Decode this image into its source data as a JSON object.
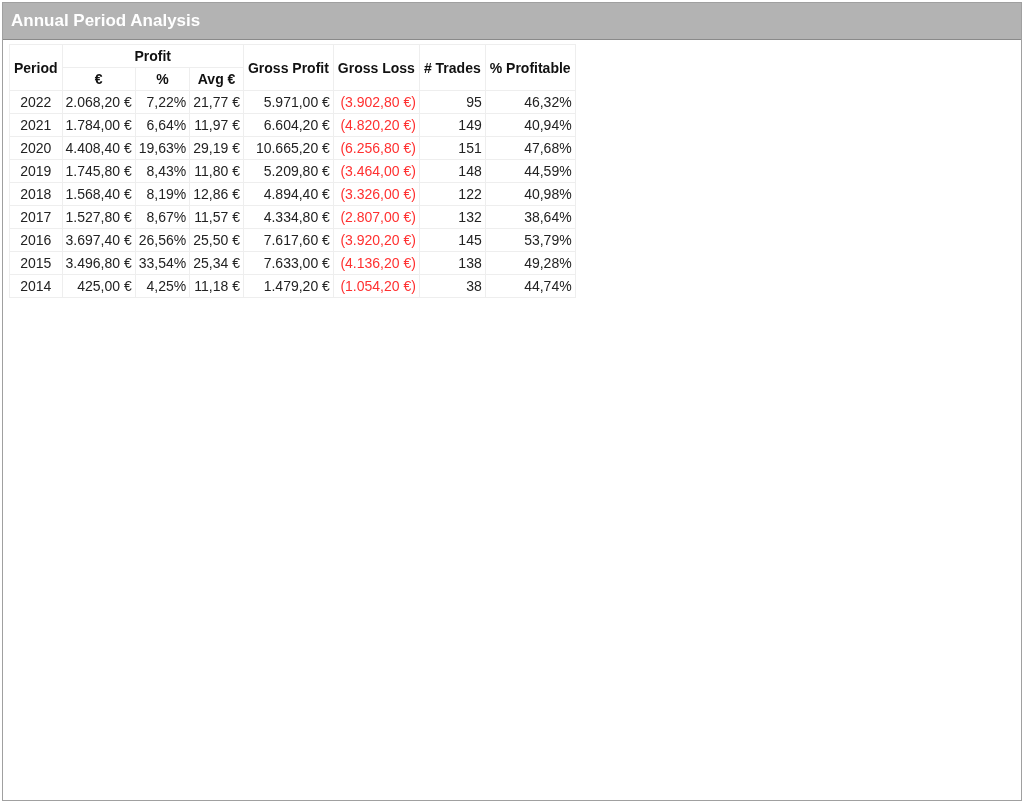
{
  "window": {
    "title": "Annual Period Analysis"
  },
  "table": {
    "columns": {
      "period": "Period",
      "profit": "Profit",
      "profit_sub": [
        "€",
        "%",
        "Avg €"
      ],
      "gross_profit": "Gross Profit",
      "gross_loss": "Gross Loss",
      "trades": "# Trades",
      "pct_profitable": "% Profitable"
    },
    "rows": [
      [
        "2022",
        "2.068,20 €",
        "7,22%",
        "21,77 €",
        "5.971,00 €",
        "(3.902,80 €)",
        "95",
        "46,32%"
      ],
      [
        "2021",
        "1.784,00 €",
        "6,64%",
        "11,97 €",
        "6.604,20 €",
        "(4.820,20 €)",
        "149",
        "40,94%"
      ],
      [
        "2020",
        "4.408,40 €",
        "19,63%",
        "29,19 €",
        "10.665,20 €",
        "(6.256,80 €)",
        "151",
        "47,68%"
      ],
      [
        "2019",
        "1.745,80 €",
        "8,43%",
        "11,80 €",
        "5.209,80 €",
        "(3.464,00 €)",
        "148",
        "44,59%"
      ],
      [
        "2018",
        "1.568,40 €",
        "8,19%",
        "12,86 €",
        "4.894,40 €",
        "(3.326,00 €)",
        "122",
        "40,98%"
      ],
      [
        "2017",
        "1.527,80 €",
        "8,67%",
        "11,57 €",
        "4.334,80 €",
        "(2.807,00 €)",
        "132",
        "38,64%"
      ],
      [
        "2016",
        "3.697,40 €",
        "26,56%",
        "25,50 €",
        "7.617,60 €",
        "(3.920,20 €)",
        "145",
        "53,79%"
      ],
      [
        "2015",
        "3.496,80 €",
        "33,54%",
        "25,34 €",
        "7.633,00 €",
        "(4.136,20 €)",
        "138",
        "49,28%"
      ],
      [
        "2014",
        "425,00 €",
        "4,25%",
        "11,18 €",
        "1.479,20 €",
        "(1.054,20 €)",
        "38",
        "44,74%"
      ]
    ]
  }
}
